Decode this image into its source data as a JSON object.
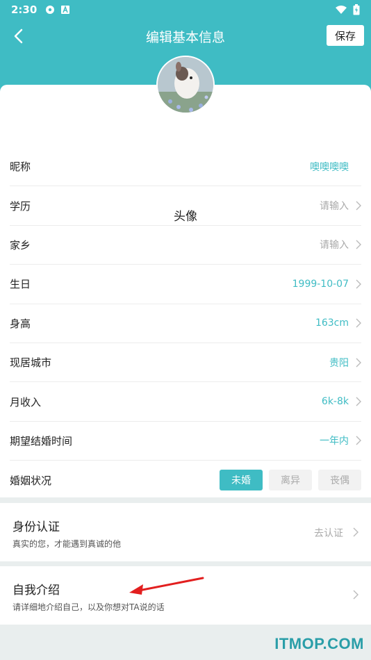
{
  "status_bar": {
    "time": "2:30"
  },
  "nav": {
    "title": "编辑基本信息",
    "save_label": "保存"
  },
  "avatar": {
    "label": "头像"
  },
  "rows": [
    {
      "label": "昵称",
      "value": "噢噢噢噢",
      "value_style": "teal",
      "chevron": false
    },
    {
      "label": "学历",
      "value": "请输入",
      "value_style": "gray",
      "chevron": true
    },
    {
      "label": "家乡",
      "value": "请输入",
      "value_style": "gray",
      "chevron": true
    },
    {
      "label": "生日",
      "value": "1999-10-07",
      "value_style": "teal",
      "chevron": true
    },
    {
      "label": "身高",
      "value": "163cm",
      "value_style": "teal",
      "chevron": true
    },
    {
      "label": "现居城市",
      "value": "贵阳",
      "value_style": "teal",
      "chevron": true
    },
    {
      "label": "月收入",
      "value": "6k-8k",
      "value_style": "teal",
      "chevron": true
    },
    {
      "label": "期望结婚时间",
      "value": "一年内",
      "value_style": "teal",
      "chevron": true
    }
  ],
  "marital": {
    "label": "婚姻状况",
    "options": [
      "未婚",
      "离异",
      "丧偶"
    ],
    "selected": "未婚"
  },
  "identity": {
    "title": "身份认证",
    "subtitle": "真实的您，才能遇到真诚的他",
    "action": "去认证"
  },
  "intro": {
    "title": "自我介绍",
    "subtitle": "请详细地介绍自己，以及你想对TA说的话"
  },
  "watermark": "ITMOP.COM",
  "colors": {
    "accent": "#3fbcc4",
    "placeholder": "#aaaaaa",
    "background": "#e9eeee"
  }
}
